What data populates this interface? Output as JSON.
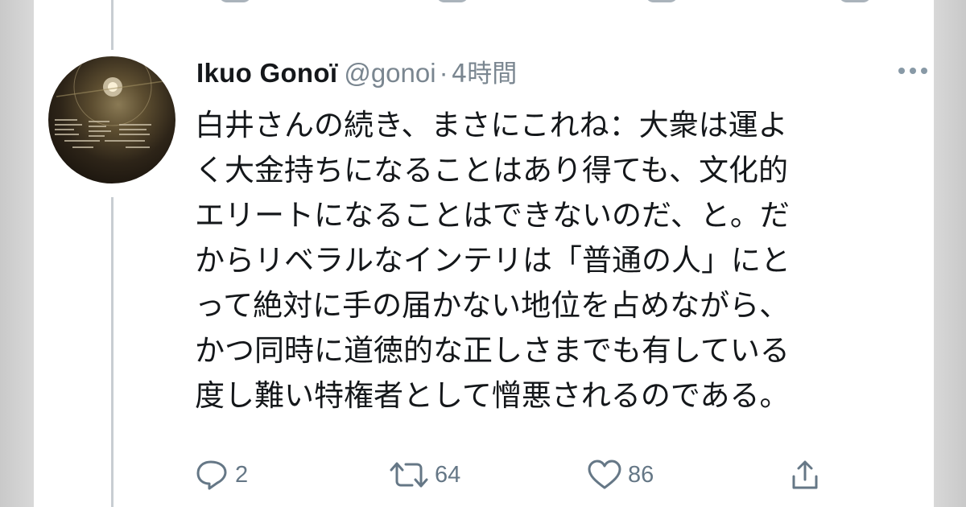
{
  "tweet": {
    "display_name": "Ikuo Gonoï",
    "handle": "@gonoi",
    "separator": "·",
    "time": "4時間",
    "text_lines": [
      "白井さんの続き、まさにこれね：大衆は運よ",
      "く大金持ちになることはあり得ても、文化的",
      "エリートになることはできないのだ、と。だ",
      "からリベラルなインテリは「普通の人」にと",
      "って絶対に手の届かない地位を占めながら、",
      "かつ同時に道徳的な正しさまでも有している",
      "度し難い特権者として憎悪されるのである。"
    ]
  },
  "actions": {
    "reply_count": "2",
    "retweet_count": "64",
    "like_count": "86",
    "reply_icon": "reply-icon",
    "retweet_icon": "retweet-icon",
    "like_icon": "heart-icon",
    "share_icon": "share-icon"
  },
  "colors": {
    "text": "#14171a",
    "secondary": "#657786",
    "thread_line": "#c8cdd2"
  }
}
